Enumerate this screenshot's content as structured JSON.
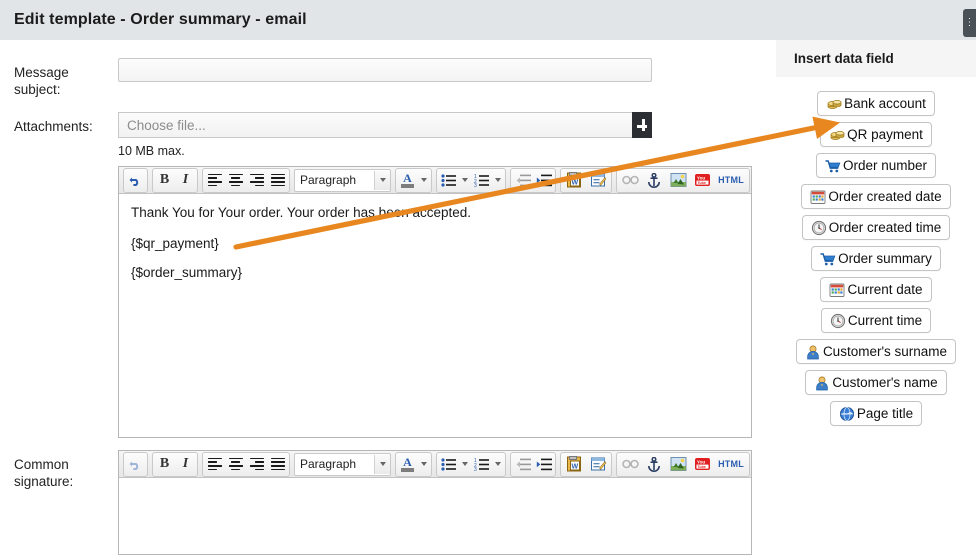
{
  "header": {
    "title": "Edit template - Order summary - email",
    "corner_button_label": "⋮"
  },
  "form": {
    "subject": {
      "label": "Message subject:",
      "value": "",
      "placeholder": ""
    },
    "attachments": {
      "label": "Attachments:",
      "value": "",
      "placeholder": "Choose file...",
      "add_button_icon": "plus-icon",
      "hint": "10 MB max."
    },
    "signature": {
      "label": "Common signature:"
    }
  },
  "editor": {
    "toolbar": {
      "undo": "undo-icon",
      "bold": "B",
      "italic": "I",
      "align_left": "align-left-icon",
      "align_center": "align-center-icon",
      "align_right": "align-right-icon",
      "align_justify": "align-justify-icon",
      "paragraph_select": "Paragraph",
      "font_color": "A",
      "bullet_list": "bullet-list-icon",
      "numbered_list": "numbered-list-icon",
      "outdent": "outdent-icon",
      "indent": "indent-icon",
      "paste_word": "paste-from-word-icon",
      "edit_source": "edit-source-icon",
      "link": "link-icon",
      "anchor": "anchor-icon",
      "image": "image-icon",
      "youtube": "youtube-icon",
      "html": "HTML"
    },
    "message_body": {
      "line1": "Thank You for Your order. Your order has been accepted.",
      "line2": "{$qr_payment}",
      "line3": "{$order_summary}"
    },
    "signature_body": ""
  },
  "sidebar": {
    "title": "Insert data field",
    "items": [
      {
        "label": "Bank account",
        "icon": "coins-icon"
      },
      {
        "label": "QR payment",
        "icon": "coins-icon"
      },
      {
        "label": "Order number",
        "icon": "cart-icon"
      },
      {
        "label": "Order created date",
        "icon": "calendar-icon"
      },
      {
        "label": "Order created time",
        "icon": "clock-icon"
      },
      {
        "label": "Order summary",
        "icon": "cart-icon"
      },
      {
        "label": "Current date",
        "icon": "calendar-icon"
      },
      {
        "label": "Current time",
        "icon": "clock-icon"
      },
      {
        "label": "Customer's surname",
        "icon": "user-icon"
      },
      {
        "label": "Customer's name",
        "icon": "user-icon"
      },
      {
        "label": "Page title",
        "icon": "globe-icon"
      }
    ]
  },
  "annotation": {
    "arrow_color": "#e8871f",
    "points_from": "{$qr_payment}",
    "points_to": "QR payment"
  },
  "colors": {
    "header_bg": "#e1e5e8",
    "sidebar_header_bg": "#f5f5f5",
    "accent_dark": "#2b2f33",
    "arrow": "#e8871f"
  }
}
